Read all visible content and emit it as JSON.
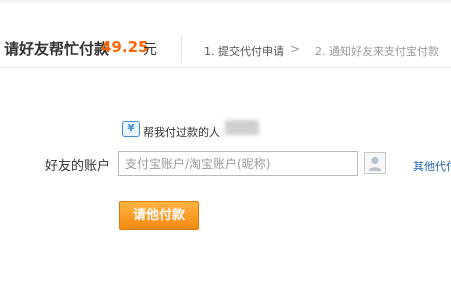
{
  "header": {
    "title": "请好友帮忙付款",
    "amount": "49.25",
    "unit": "元",
    "steps": [
      {
        "label": "1. 提交代付申请"
      },
      {
        "label": "2. 通知好友来支付宝付款"
      }
    ],
    "step_separator": ">"
  },
  "hint": {
    "icon": "yen-card-icon",
    "text": "帮我付过款的人"
  },
  "form": {
    "label": "好友的账户",
    "placeholder": "支付宝账户/淘宝账户(昵称)",
    "value": "",
    "other_link": "其他代付"
  },
  "submit": {
    "label": "请他付款"
  },
  "colors": {
    "amount": "#ff6600",
    "link": "#1a66b3",
    "button": "#f48a12"
  }
}
